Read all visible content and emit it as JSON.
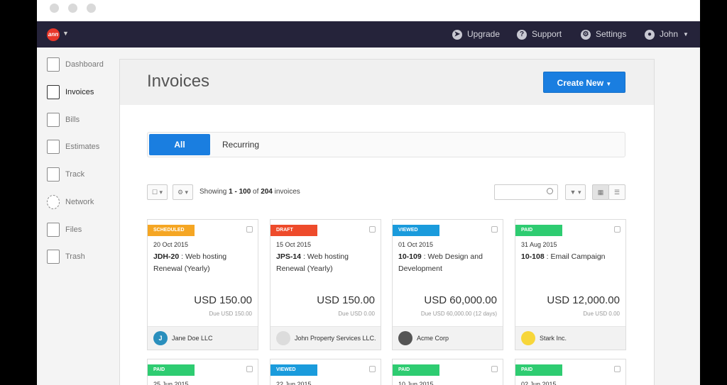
{
  "topbar": {
    "logo": "ann",
    "upgrade": "Upgrade",
    "support": "Support",
    "settings": "Settings",
    "user": "John",
    "icons": [
      "rocket-icon",
      "help-icon",
      "gear-icon",
      "user-icon"
    ]
  },
  "sidebar": {
    "items": [
      {
        "label": "Dashboard",
        "icon": "monitor-icon"
      },
      {
        "label": "Invoices",
        "icon": "invoice-icon"
      },
      {
        "label": "Bills",
        "icon": "bill-icon"
      },
      {
        "label": "Estimates",
        "icon": "estimate-icon"
      },
      {
        "label": "Track",
        "icon": "clipboard-icon"
      },
      {
        "label": "Network",
        "icon": "network-icon"
      },
      {
        "label": "Files",
        "icon": "files-icon"
      },
      {
        "label": "Trash",
        "icon": "trash-icon"
      }
    ],
    "active": "Invoices"
  },
  "main": {
    "title": "Invoices",
    "create_button": "Create New",
    "tabs": [
      "All",
      "Recurring"
    ],
    "showing_prefix": "Showing ",
    "showing_range": "1 - 100",
    "showing_of": " of ",
    "showing_total": "204",
    "showing_suffix": " invoices"
  },
  "cards": [
    {
      "status": "SCHEDULED",
      "color": "#f5a623",
      "date": "20 Oct 2015",
      "id": "JDH-20",
      "title": "Web hosting Renewal (Yearly)",
      "amount": "USD 150.00",
      "due": "Due USD 150.00",
      "client": "Jane Doe LLC",
      "avatar_letter": "J",
      "avatar_color": "#2a8fbd"
    },
    {
      "status": "DRAFT",
      "color": "#ee4b2b",
      "date": "15 Oct 2015",
      "id": "JPS-14",
      "title": "Web hosting Renewal (Yearly)",
      "amount": "USD 150.00",
      "due": "Due USD 0.00",
      "client": "John Property Services LLC.",
      "avatar_letter": "",
      "avatar_color": "#dcdcdc"
    },
    {
      "status": "VIEWED",
      "color": "#1a9bdc",
      "date": "01 Oct 2015",
      "id": "10-109",
      "title": "Web Design and Development",
      "amount": "USD 60,000.00",
      "due": "Due USD 60,000.00 (12 days)",
      "client": "Acme Corp",
      "avatar_letter": "",
      "avatar_color": "#555"
    },
    {
      "status": "PAID",
      "color": "#2ecc71",
      "date": "31 Aug 2015",
      "id": "10-108",
      "title": "Email Campaign",
      "amount": "USD 12,000.00",
      "due": "Due USD 0.00",
      "client": "Stark Inc.",
      "avatar_letter": "",
      "avatar_color": "#f7d63a"
    }
  ],
  "cards_row2": [
    {
      "status": "PAID",
      "color": "#2ecc71",
      "date": "25 Jun 2015"
    },
    {
      "status": "VIEWED",
      "color": "#1a9bdc",
      "date": "22 Jun 2015"
    },
    {
      "status": "PAID",
      "color": "#2ecc71",
      "date": "10 Jun 2015"
    },
    {
      "status": "PAID",
      "color": "#2ecc71",
      "date": "02 Jun 2015"
    }
  ]
}
